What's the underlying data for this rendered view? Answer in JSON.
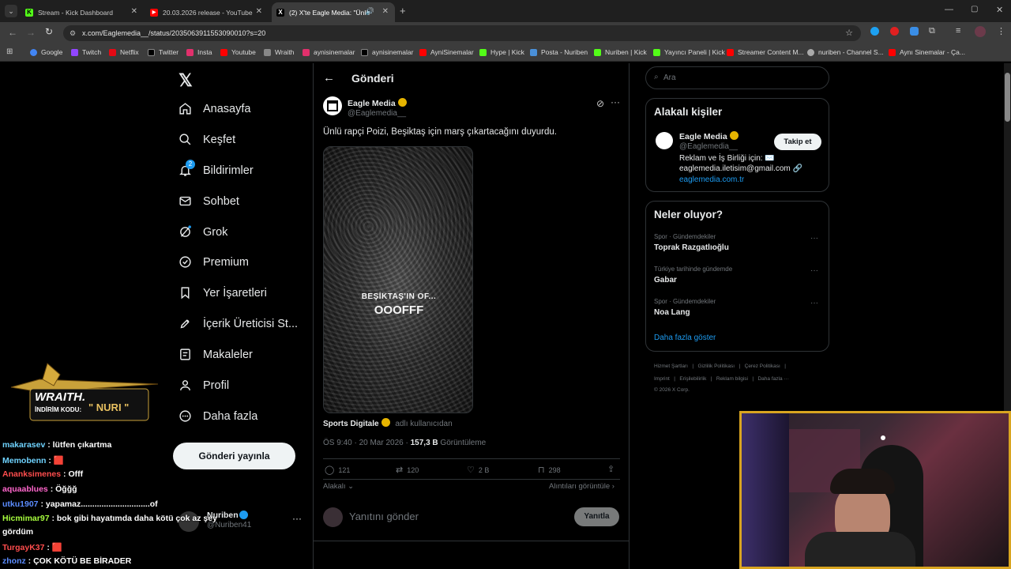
{
  "browser": {
    "tabs": [
      {
        "title": "Stream - Kick Dashboard",
        "icon": "kick-icon"
      },
      {
        "title": "20.03.2026 release - YouTube",
        "icon": "youtube-icon"
      },
      {
        "title": "(2) X'te Eagle Media: \"Ünlü",
        "icon": "x-icon"
      }
    ],
    "url": "x.com/Eaglemedia__/status/2035063911553090010?s=20",
    "bookmarks": [
      "Google",
      "Twitch",
      "Netflix",
      "Twitter",
      "Insta",
      "Youtube",
      "Wraith",
      "aynisinemalar",
      "aynisinemalar",
      "AyniSinemalar",
      "Hype | Kick",
      "Posta - Nuriben",
      "Nuriben | Kick",
      "Yayıncı Paneli | Kick",
      "Streamer Content M...",
      "nuriben - Channel S...",
      "Aynı Sinemalar - Ça..."
    ]
  },
  "nav": {
    "items": [
      "Anasayfa",
      "Keşfet",
      "Bildirimler",
      "Sohbet",
      "Grok",
      "Premium",
      "Yer İşaretleri",
      "İçerik Üreticisi St...",
      "Makaleler",
      "Profil",
      "Daha fazla"
    ],
    "notif_count": "2",
    "post_button": "Gönderi yayınla",
    "account_name": "Nuriben",
    "account_handle": "@Nuriben41"
  },
  "post": {
    "header": "Gönderi",
    "author_name": "Eagle Media",
    "author_handle": "@Eaglemedia__",
    "text": "Ünlü rapçi Poizi, Beşiktaş için marş çıkartacağını duyurdu.",
    "image_caption_1": "BEŞİKTAŞ'IN OF...",
    "image_caption_2": "OOOFFF",
    "source_name": "Sports Digitale",
    "source_suffix": "adlı kullanıcıdan",
    "meta_time": "ÖS 9:40 · 20 Mar 2026 · ",
    "meta_views": "157,3 B",
    "meta_views_label": " Görüntüleme",
    "stats": {
      "replies": "121",
      "reposts": "120",
      "likes": "2 B",
      "bookmarks": "298"
    },
    "relevant_label": "Alakalı",
    "quotes_label": "Alıntıları görüntüle",
    "reply_placeholder": "Yanıtını gönder",
    "reply_button": "Yanıtla"
  },
  "sidebar": {
    "search_placeholder": "Ara",
    "people_title": "Alakalı kişiler",
    "person_name": "Eagle Media",
    "person_handle": "@Eaglemedia__",
    "follow_label": "Takip et",
    "bio_line1": "Reklam ve İş Birliği için: ✉️",
    "bio_line2": "eaglemedia.iletisim@gmail.com 🔗",
    "bio_link": "eaglemedia.com.tr",
    "trends_title": "Neler oluyor?",
    "trends": [
      {
        "context": "Spor · Gündemdekiler",
        "name": "Toprak Razgatlıoğlu"
      },
      {
        "context": "Türkiye tarihinde gündemde",
        "name": "Gabar"
      },
      {
        "context": "Spor · Gündemdekiler",
        "name": "Noa Lang"
      }
    ],
    "show_more": "Daha fazla göster",
    "footer1": "Hizmet Şartları   |   Gizlilik Politikası   |   Çerez Politikası   |",
    "footer2": "Imprint   |   Erişilebilirlik   |   Reklam bilgisi   |   Daha fazla ···",
    "footer3": "© 2026 X Corp."
  },
  "overlay": {
    "logo_text": "WRAITH.",
    "promo_label": "İNDİRİM KODU:",
    "promo_code": "\" NURI \"",
    "chat": [
      {
        "user": "makarasev",
        "msg": " : lütfen çıkartma",
        "color": "#6fd3ff"
      },
      {
        "user": "Memobenn",
        "msg": " : 🟥",
        "color": "#6fd3ff"
      },
      {
        "user": "Ananksimenes",
        "msg": " : Offf",
        "color": "#ff4d4d"
      },
      {
        "user": "aquaablues",
        "msg": " : Öğğğ",
        "color": "#ff66cc"
      },
      {
        "user": "utku1907",
        "msg": " : yapamaz..............................of",
        "color": "#5b8cff"
      },
      {
        "user": "Hicmimar97",
        "msg": " : bok gibi hayatımda daha kötü çok az şey",
        "color": "#a8ff3e"
      },
      {
        "user": "",
        "msg": "gördüm",
        "color": "#ffffff"
      },
      {
        "user": "TurgayK37",
        "msg": " : 🟥",
        "color": "#ff4d4d"
      },
      {
        "user": "zhonz",
        "msg": " : ÇOK KÖTÜ BE BİRADER",
        "color": "#5b8cff"
      }
    ]
  }
}
